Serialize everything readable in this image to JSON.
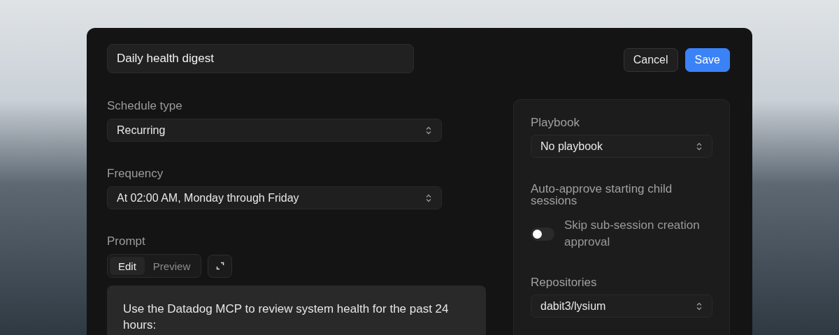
{
  "title_field": {
    "value": "Daily health digest"
  },
  "buttons": [
    {
      "label": "Cancel",
      "kind": "secondary"
    },
    {
      "label": "Save",
      "kind": "primary"
    }
  ],
  "fields": [
    {
      "label": "Schedule type",
      "value": "Recurring"
    },
    {
      "label": "Frequency",
      "value": "At 02:00 AM, Monday through Friday"
    }
  ],
  "prompt": {
    "label": "Prompt",
    "tabs": [
      {
        "label": "Edit",
        "selected": true
      },
      {
        "label": "Preview",
        "selected": false
      }
    ],
    "text": "Use the Datadog MCP to review system health for the past 24 hours:"
  },
  "side_panel": {
    "playbook": {
      "label": "Playbook",
      "value": "No playbook"
    },
    "auto_approve": {
      "label": "Auto-approve starting child sessions",
      "toggle_label": "Skip sub-session creation approval",
      "on": false
    },
    "repositories": {
      "label": "Repositories",
      "value": "dabit3/lysium"
    }
  }
}
